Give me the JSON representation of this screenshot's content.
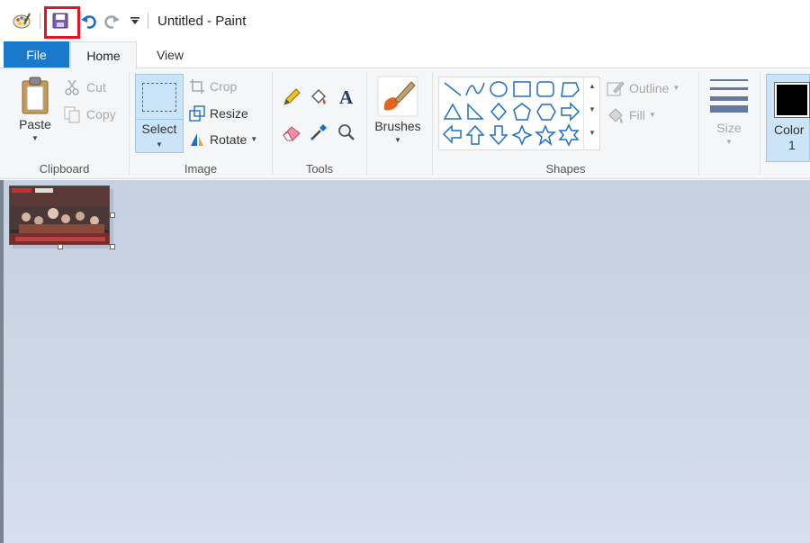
{
  "window": {
    "title": "Untitled - Paint"
  },
  "quick_access": {
    "app_icon": "paint-app-icon",
    "save_icon": "save-disk-icon",
    "undo_icon": "undo-arrow-icon",
    "redo_icon": "redo-arrow-icon",
    "customize_icon": "customize-dropdown-icon",
    "highlight_color": "#e81123"
  },
  "tabs": [
    {
      "label": "File"
    },
    {
      "label": "Home"
    },
    {
      "label": "View"
    }
  ],
  "ribbon": {
    "clipboard": {
      "label": "Clipboard",
      "paste": "Paste",
      "cut": "Cut",
      "copy": "Copy"
    },
    "image": {
      "label": "Image",
      "select": "Select",
      "crop": "Crop",
      "resize": "Resize",
      "rotate": "Rotate"
    },
    "tools": {
      "label": "Tools"
    },
    "brushes": {
      "label": "Brushes"
    },
    "shapes": {
      "label": "Shapes",
      "outline": "Outline",
      "fill": "Fill"
    },
    "size": {
      "label": "Size"
    },
    "color": {
      "label_line1": "Color",
      "label_line2": "1"
    }
  },
  "colors": {
    "accent": "#1979ca",
    "ribbon_bg": "#f5f6f7",
    "selected_bg": "#cce4f7",
    "workspace_bg": "#cdd7e6"
  }
}
